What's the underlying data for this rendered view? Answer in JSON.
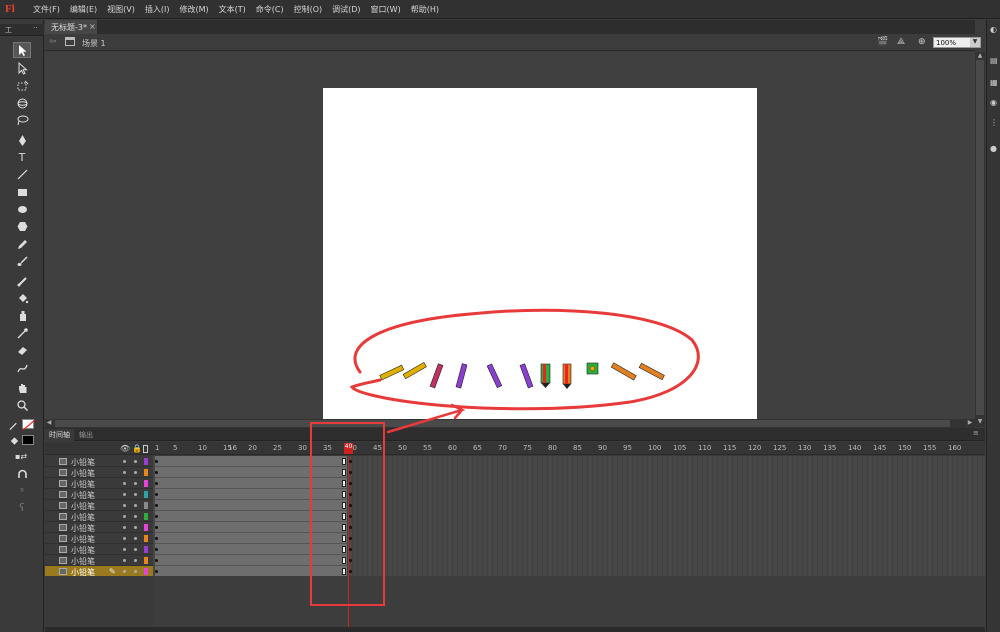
{
  "app": {
    "logo": "Fl"
  },
  "menu": [
    "文件(F)",
    "编辑(E)",
    "视图(V)",
    "插入(I)",
    "修改(M)",
    "文本(T)",
    "命令(C)",
    "控制(O)",
    "调试(D)",
    "窗口(W)",
    "帮助(H)"
  ],
  "document": {
    "tab_label": "无标题-3*",
    "close_glyph": "×"
  },
  "scene": {
    "label": "场景 1"
  },
  "zoom": {
    "value": "100%"
  },
  "tools_panel": {
    "header_left": "工",
    "header_right": "··"
  },
  "timeline": {
    "tabs": [
      "时间轴",
      "输出"
    ],
    "ruler_ticks": [
      "1",
      "5",
      "10",
      "15",
      "20",
      "25",
      "30",
      "35",
      "40",
      "45",
      "50",
      "55",
      "60",
      "65",
      "70",
      "75",
      "80",
      "85",
      "90",
      "95",
      "100",
      "105",
      "110",
      "115",
      "120",
      "125",
      "130",
      "135",
      "140",
      "145",
      "150",
      "155",
      "160",
      "16"
    ],
    "current_frame": "40",
    "layers": [
      {
        "name": "小铅笔",
        "color": "#9b3dd1"
      },
      {
        "name": "小铅笔",
        "color": "#e8841c"
      },
      {
        "name": "小铅笔",
        "color": "#e444d8"
      },
      {
        "name": "小铅笔",
        "color": "#2aa6a6"
      },
      {
        "name": "小铅笔",
        "color": "#8a8a8a"
      },
      {
        "name": "小铅笔",
        "color": "#2fae3f"
      },
      {
        "name": "小铅笔",
        "color": "#e444d8"
      },
      {
        "name": "小铅笔",
        "color": "#e8841c"
      },
      {
        "name": "小铅笔",
        "color": "#9b3dd1"
      },
      {
        "name": "小铅笔",
        "color": "#e8841c"
      },
      {
        "name": "小铅笔",
        "color": "#e444d8"
      }
    ],
    "selected_layer_index": 10
  },
  "colors": {
    "accent_annotation": "#e83a3a",
    "selected_layer": "#9a7a1f",
    "playhead": "#cc2222"
  }
}
